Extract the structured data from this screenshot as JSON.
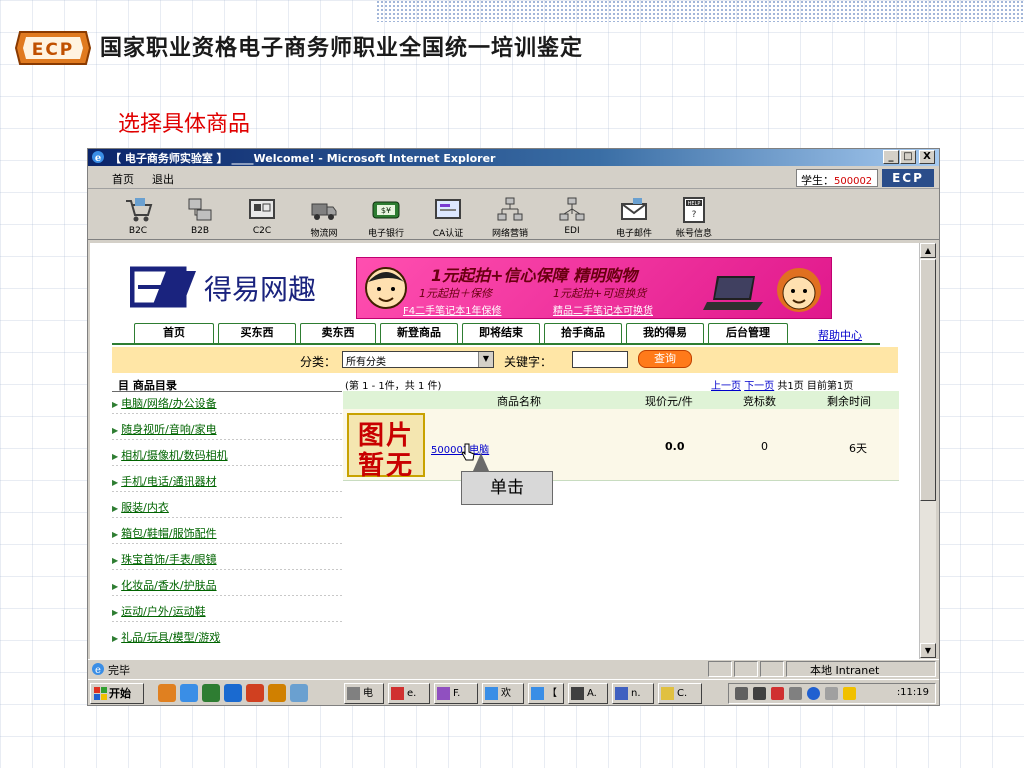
{
  "slide": {
    "logo_text": "ECP",
    "title": "国家职业资格电子商务师职业全国统一培训鉴定",
    "subtitle": "选择具体商品"
  },
  "window": {
    "title": "【 电子商务师实验室 】 ____Welcome! - Microsoft Internet Explorer",
    "btn_min": "_",
    "btn_max": "□",
    "btn_close": "X"
  },
  "menubar": {
    "home": "首页",
    "exit": "退出",
    "student_label": "学生：",
    "student_id": "500002",
    "badge": "ECP"
  },
  "toolbar": {
    "items": [
      {
        "label": "B2C",
        "icon": "cart-icon"
      },
      {
        "label": "B2B",
        "icon": "building-icon"
      },
      {
        "label": "C2C",
        "icon": "c2c-icon"
      },
      {
        "label": "物流网",
        "icon": "truck-icon"
      },
      {
        "label": "电子银行",
        "icon": "bank-icon"
      },
      {
        "label": "CA认证",
        "icon": "certificate-icon"
      },
      {
        "label": "网络营销",
        "icon": "network-icon"
      },
      {
        "label": "EDI",
        "icon": "edi-icon"
      },
      {
        "label": "电子邮件",
        "icon": "email-icon"
      },
      {
        "label": "帐号信息",
        "icon": "help-icon"
      }
    ]
  },
  "site": {
    "logo_text": "得易网趣",
    "banner": {
      "line1": "1元起拍+信心保障 精明购物",
      "line2a": "1元起拍＋保修",
      "line2b": "1元起拍+可退换货",
      "link1": "F4二手笔记本1年保修",
      "link2": "精品二手笔记本可换货"
    },
    "tabs": [
      "首页",
      "买东西",
      "卖东西",
      "新登商品",
      "即将结束",
      "拾手商品",
      "我的得易",
      "后台管理"
    ],
    "help_link": "帮助中心"
  },
  "filter": {
    "category_label": "分类：",
    "category_value": "所有分类",
    "keyword_label": "关键字：",
    "keyword_value": "",
    "query_button": "查询"
  },
  "catalog": {
    "heading": "目 商品目录",
    "items": [
      "电脑/网络/办公设备",
      "随身视听/音响/家电",
      "相机/摄像机/数码相机",
      "手机/电话/通讯器材",
      "服装/内衣",
      "箱包/鞋帽/服饰配件",
      "珠宝首饰/手表/眼镜",
      "化妆品/香水/护肤品",
      "运动/户外/运动鞋",
      "礼品/玩具/模型/游戏"
    ]
  },
  "products": {
    "range_text": "(第 1 - 1件，共 1 件)",
    "pager": {
      "prev": "上一页",
      "next": "下一页",
      "total": "共1页 目前第1页"
    },
    "headers": {
      "name": "商品名称",
      "price": "现价元/件",
      "bids": "竞标数",
      "remaining": "剩余时间"
    },
    "rows": [
      {
        "image_text_1": "图片",
        "image_text_2": "暂无",
        "name": "500002电脑",
        "price": "0.0",
        "bids": "0",
        "remaining": "6天"
      }
    ]
  },
  "callout": "单击",
  "statusbar": {
    "status": "完毕",
    "zone": "本地 Intranet"
  },
  "taskbar": {
    "start": "开始",
    "tasks": [
      "电",
      "e.",
      "F.",
      "欢",
      "【",
      "A.",
      "n.",
      "C."
    ],
    "clock": ":11:19"
  }
}
